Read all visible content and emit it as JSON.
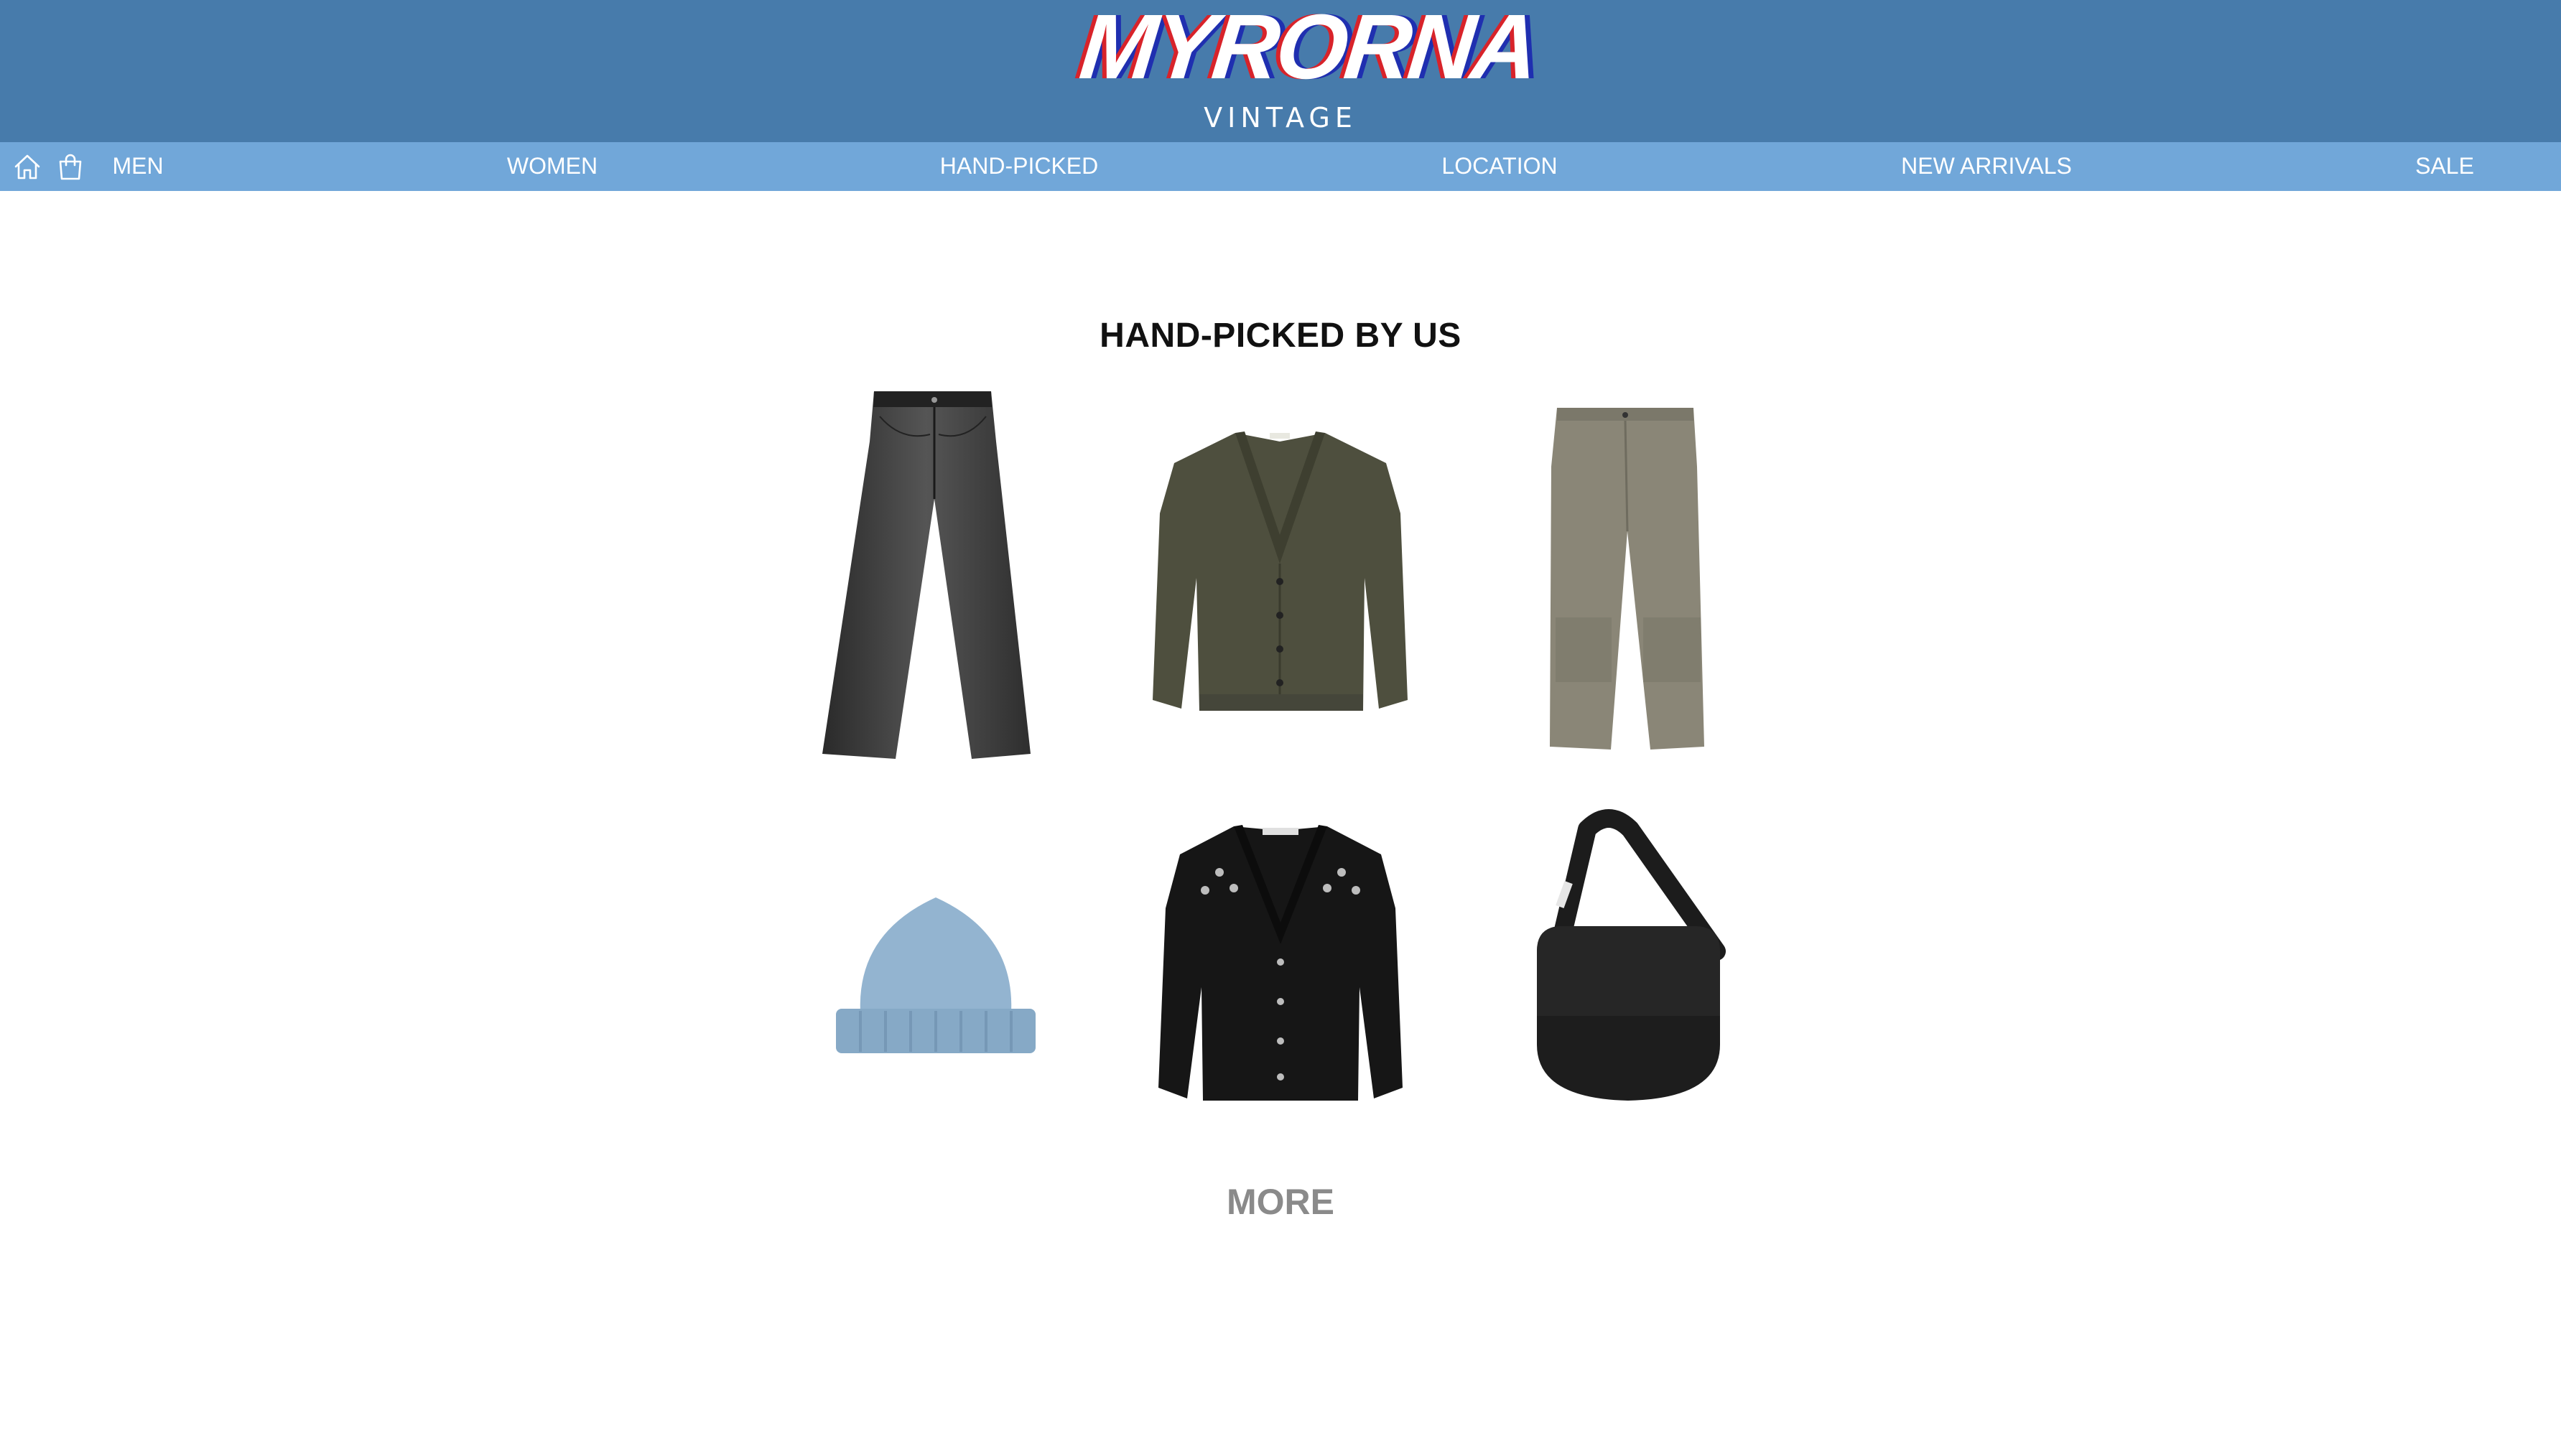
{
  "brand": {
    "name": "MYRORNA",
    "tagline": "VINTAGE"
  },
  "nav": {
    "icons": [
      "home-icon",
      "shopping-bag-icon"
    ],
    "links": [
      "MEN",
      "WOMEN",
      "HAND-PICKED",
      "LOCATION",
      "NEW ARRIVALS",
      "SALE"
    ]
  },
  "section": {
    "title": "HAND-PICKED BY US",
    "more_label": "MORE"
  },
  "products": [
    {
      "item": "black-jeans",
      "color": "#3a3a3a"
    },
    {
      "item": "olive-cardigan",
      "color": "#4f4f3f"
    },
    {
      "item": "khaki-work-pants",
      "color": "#8a8677"
    },
    {
      "item": "blue-beanie",
      "color": "#8fb2cf"
    },
    {
      "item": "black-cardigan",
      "color": "#1a1a1a"
    },
    {
      "item": "black-shoulder-bag",
      "color": "#1c1c1c"
    }
  ],
  "colors": {
    "header": "#477bab",
    "nav": "#71a7d9",
    "logo_red": "#d8232a",
    "logo_blue": "#1f2fb0",
    "more_text": "#8a8a8a"
  }
}
